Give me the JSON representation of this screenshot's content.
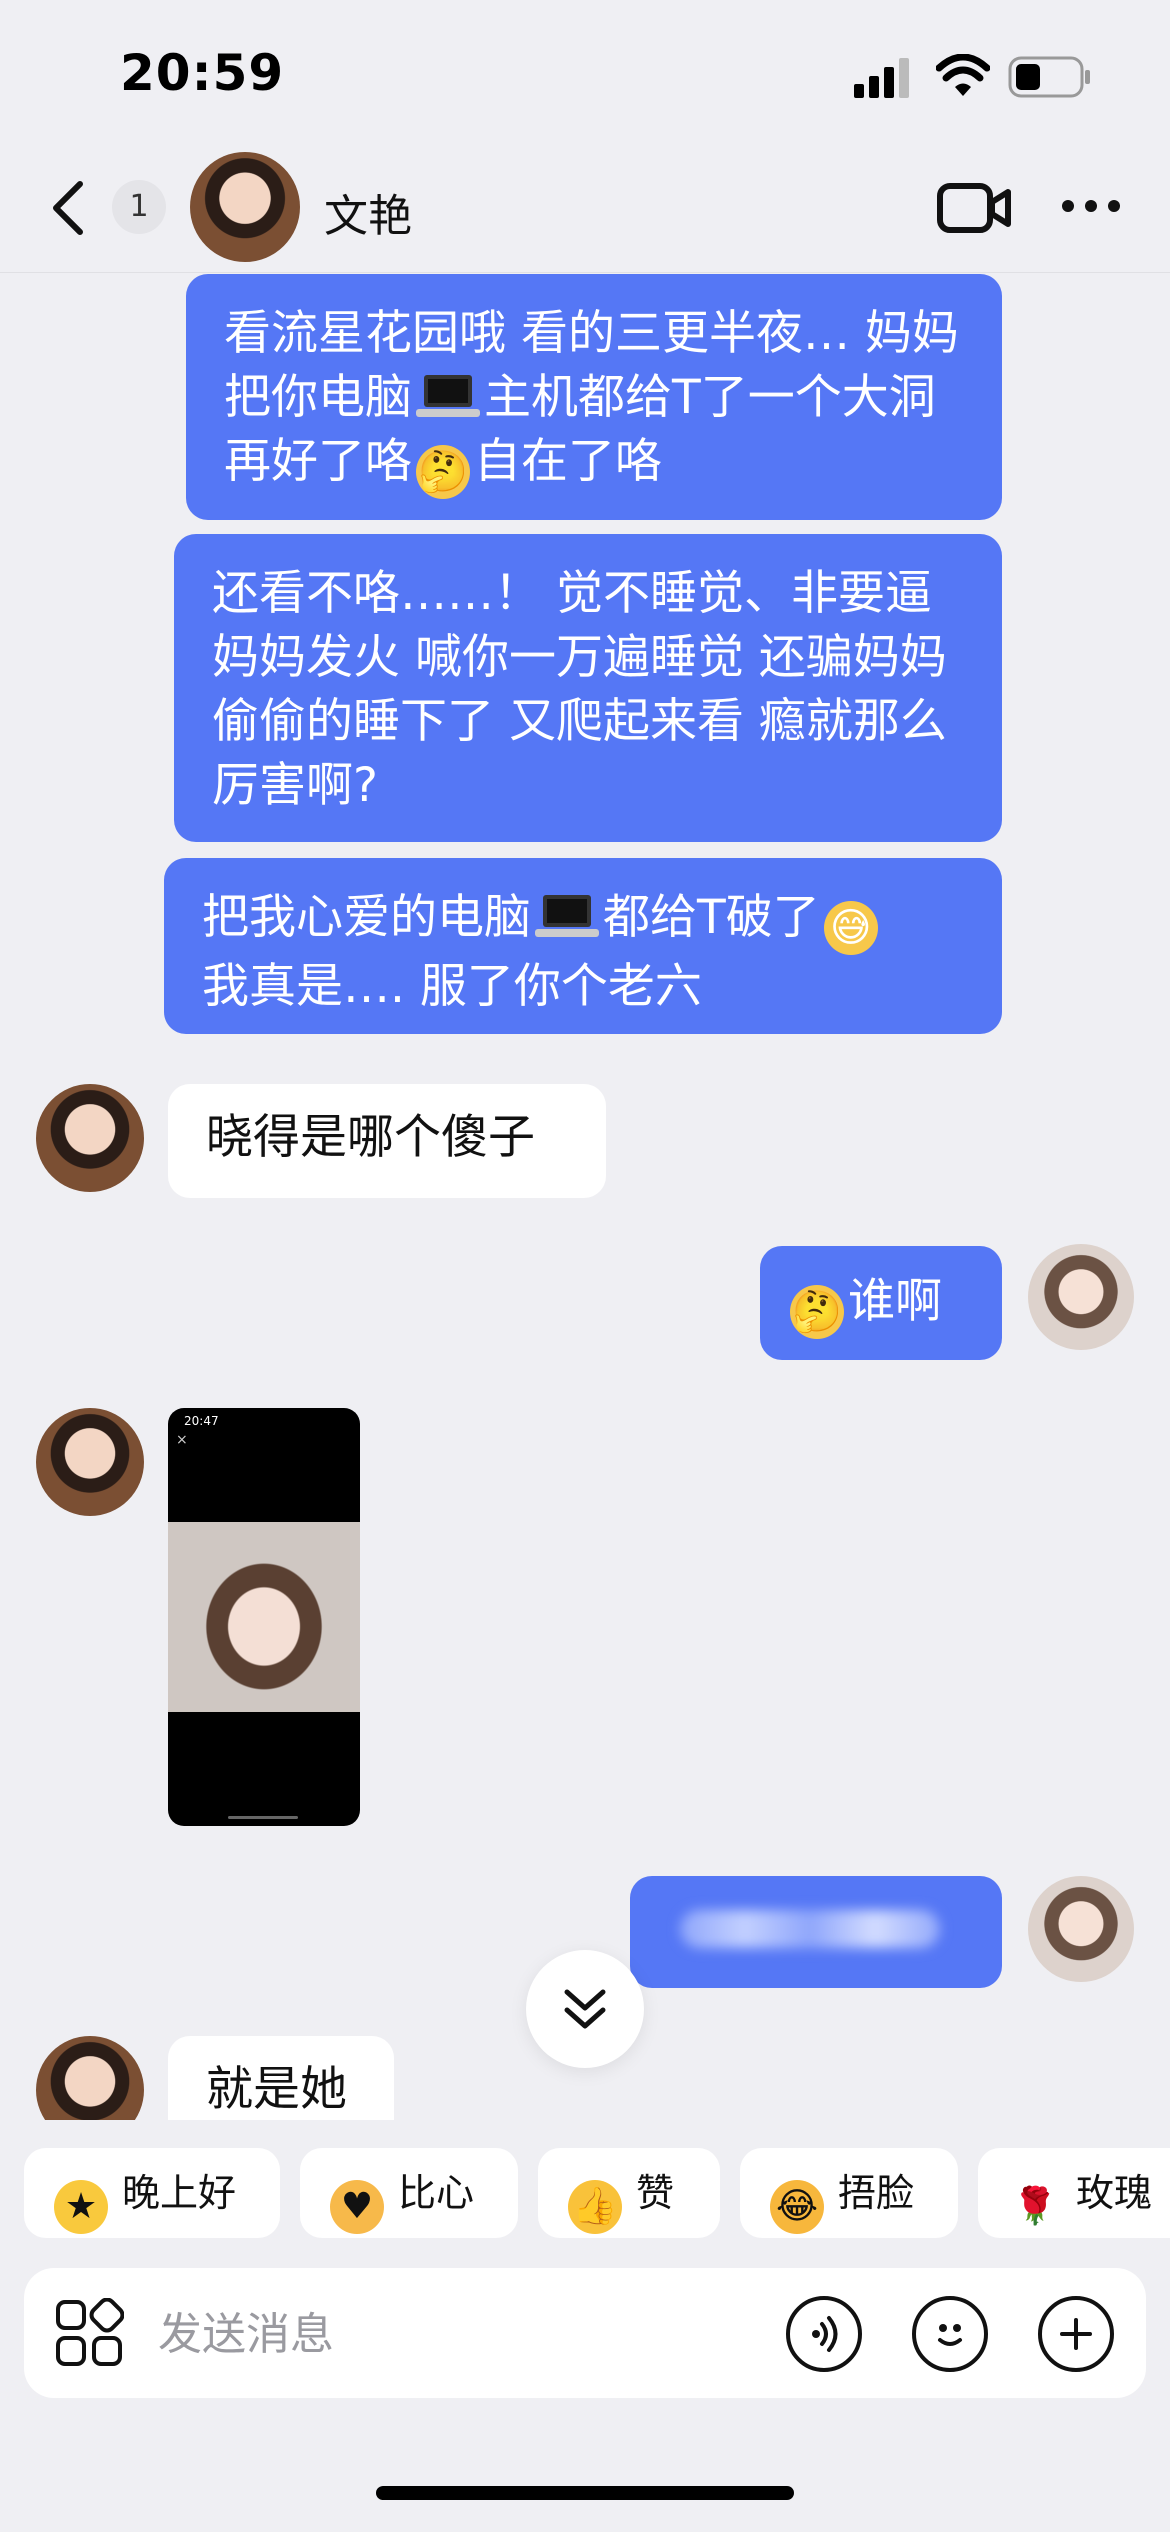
{
  "status_bar": {
    "time": "20:59"
  },
  "header": {
    "unread_count": "1",
    "contact_name": "文艳",
    "icons": [
      "back-icon",
      "video-call-icon",
      "more-icon"
    ]
  },
  "messages": [
    {
      "side": "out",
      "parts": [
        "看流星花园哦 看的三更半夜… 妈妈把你电脑",
        "主机都给T了一个大洞 再好了咯",
        "自在了咯"
      ]
    },
    {
      "side": "out",
      "text": "还看不咯……！ 觉不睡觉、非要逼妈妈发火 喊你一万遍睡觉 还骗妈妈偷偷的睡下了 又爬起来看 瘾就那么厉害啊?"
    },
    {
      "side": "out",
      "parts": [
        "把我心爱的电脑",
        "都给T破了",
        "我真是…. 服了你个老六"
      ]
    },
    {
      "side": "in",
      "text": "晓得是哪个傻子"
    },
    {
      "side": "out",
      "text": "谁啊",
      "emoji": "thinking"
    },
    {
      "side": "in",
      "type": "image",
      "screenshot_time": "20:47",
      "screenshot_close": "×"
    },
    {
      "side": "out",
      "type": "blurred"
    },
    {
      "side": "in",
      "text": "就是她"
    }
  ],
  "quick_replies": [
    {
      "label": "晚上好",
      "icon": "star-icon"
    },
    {
      "label": "比心",
      "icon": "heart-hands-icon"
    },
    {
      "label": "赞",
      "icon": "thumbs-up-icon"
    },
    {
      "label": "捂脸",
      "icon": "facepalm-icon"
    },
    {
      "label": "玫瑰",
      "icon": "rose-icon"
    }
  ],
  "input": {
    "placeholder": "发送消息"
  },
  "colors": {
    "outgoing_bubble": "#5577f5",
    "incoming_bubble": "#ffffff",
    "background": "#efeff3"
  }
}
